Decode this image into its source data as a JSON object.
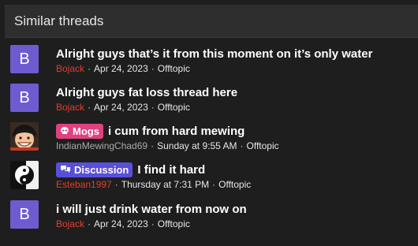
{
  "header": {
    "title": "Similar threads"
  },
  "threads": [
    {
      "avatar_letter": "B",
      "prefix": "",
      "title": "Alright guys that’s it from this moment on it’s only water",
      "user": "Bojack",
      "date": "Apr 24, 2023",
      "forum": "Offtopic",
      "user_color": "#e0402f"
    },
    {
      "avatar_letter": "B",
      "prefix": "",
      "title": "Alright guys fat loss thread here",
      "user": "Bojack",
      "date": "Apr 24, 2023",
      "forum": "Offtopic",
      "user_color": "#e0402f"
    },
    {
      "avatar_letter": "",
      "prefix": "Mogs",
      "prefix_icon": "skull-icon",
      "prefix_color": "#e0417f",
      "title": "i cum from hard mewing",
      "user": "IndianMewingChad69",
      "date": "Sunday at 9:55 AM",
      "forum": "Offtopic",
      "user_color": "#a9a9a9"
    },
    {
      "avatar_letter": "",
      "prefix": "Discussion",
      "prefix_icon": "chat-bubbles-icon",
      "prefix_color": "#5a4fd8",
      "title": "I find it hard",
      "user": "Esteban1997",
      "date": "Thursday at 7:31 PM",
      "forum": "Offtopic",
      "user_color": "#e0402f"
    },
    {
      "avatar_letter": "B",
      "prefix": "",
      "title": "i will just drink water from now on",
      "user": "Bojack",
      "date": "Apr 24, 2023",
      "forum": "Offtopic",
      "user_color": "#e0402f"
    }
  ],
  "meta_separator": "·",
  "colors": {
    "background": "#1e1e1e",
    "header": "#2e2e2e",
    "avatar": "#6f5bd0"
  }
}
